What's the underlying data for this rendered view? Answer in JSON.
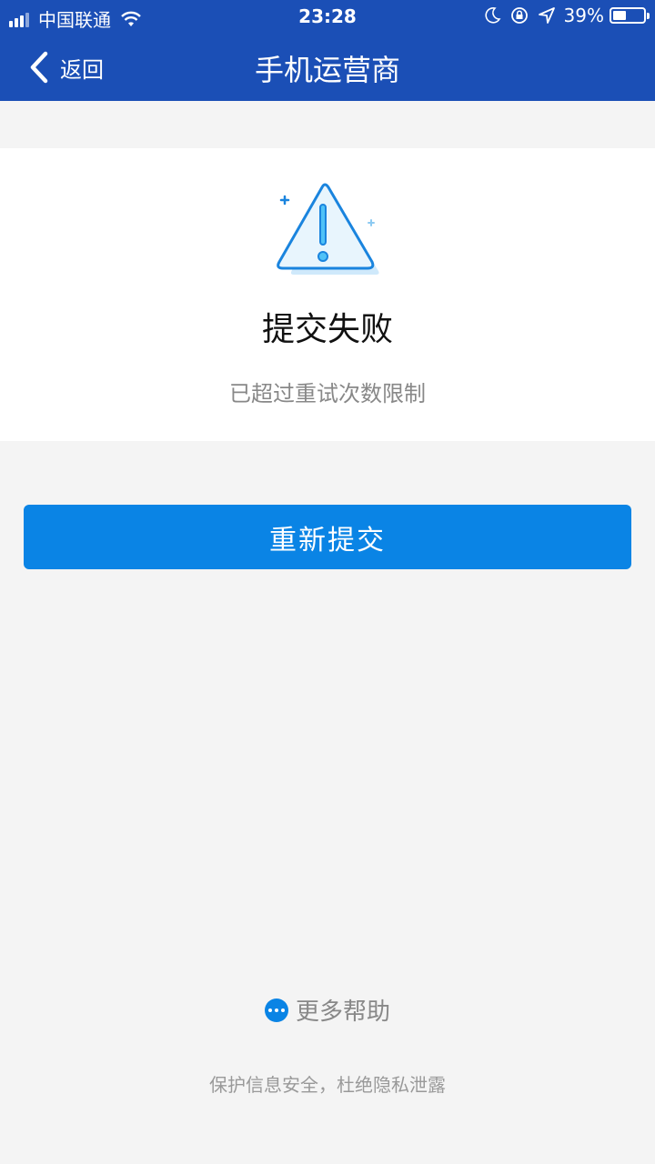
{
  "status_bar": {
    "carrier": "中国联通",
    "time": "23:28",
    "battery": "39%"
  },
  "nav": {
    "back_label": "返回",
    "title": "手机运营商"
  },
  "result": {
    "title": "提交失败",
    "description": "已超过重试次数限制"
  },
  "actions": {
    "retry_label": "重新提交"
  },
  "help": {
    "label": "更多帮助"
  },
  "footer": {
    "text": "保护信息安全，杜绝隐私泄露"
  },
  "colors": {
    "nav_bg": "#1b4fb6",
    "primary": "#0a84e5",
    "page_bg": "#f4f4f4"
  }
}
